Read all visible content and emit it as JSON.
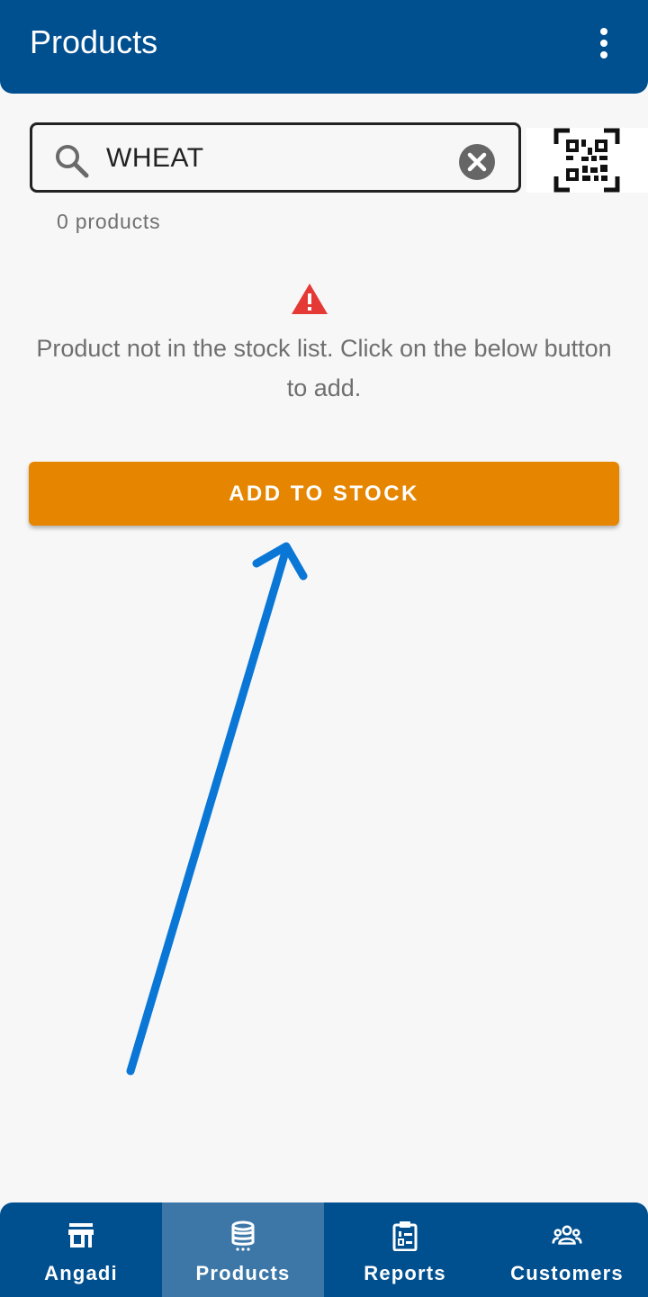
{
  "header": {
    "title": "Products",
    "menu_icon": "more-vert-icon"
  },
  "search": {
    "value": "WHEAT",
    "search_icon": "search-icon",
    "clear_icon": "clear-icon"
  },
  "scanner": {
    "icon": "qr-code-scan-icon"
  },
  "results": {
    "count_text": "0 products"
  },
  "empty_state": {
    "icon": "warning-icon",
    "message": "Product not in the stock list. Click on the below button to add."
  },
  "actions": {
    "add_to_stock_label": "ADD TO STOCK"
  },
  "annotation": {
    "arrow_color": "#0a77d6"
  },
  "bottom_nav": {
    "items": [
      {
        "label": "Angadi",
        "icon": "store-icon",
        "active": false
      },
      {
        "label": "Products",
        "icon": "database-icon",
        "active": true
      },
      {
        "label": "Reports",
        "icon": "clipboard-list-icon",
        "active": false
      },
      {
        "label": "Customers",
        "icon": "group-icon",
        "active": false
      }
    ]
  },
  "colors": {
    "primary": "#004f8f",
    "nav_active": "#3c77a8",
    "accent_button": "#e68500",
    "warning": "#e53935",
    "background": "#f7f7f7"
  }
}
